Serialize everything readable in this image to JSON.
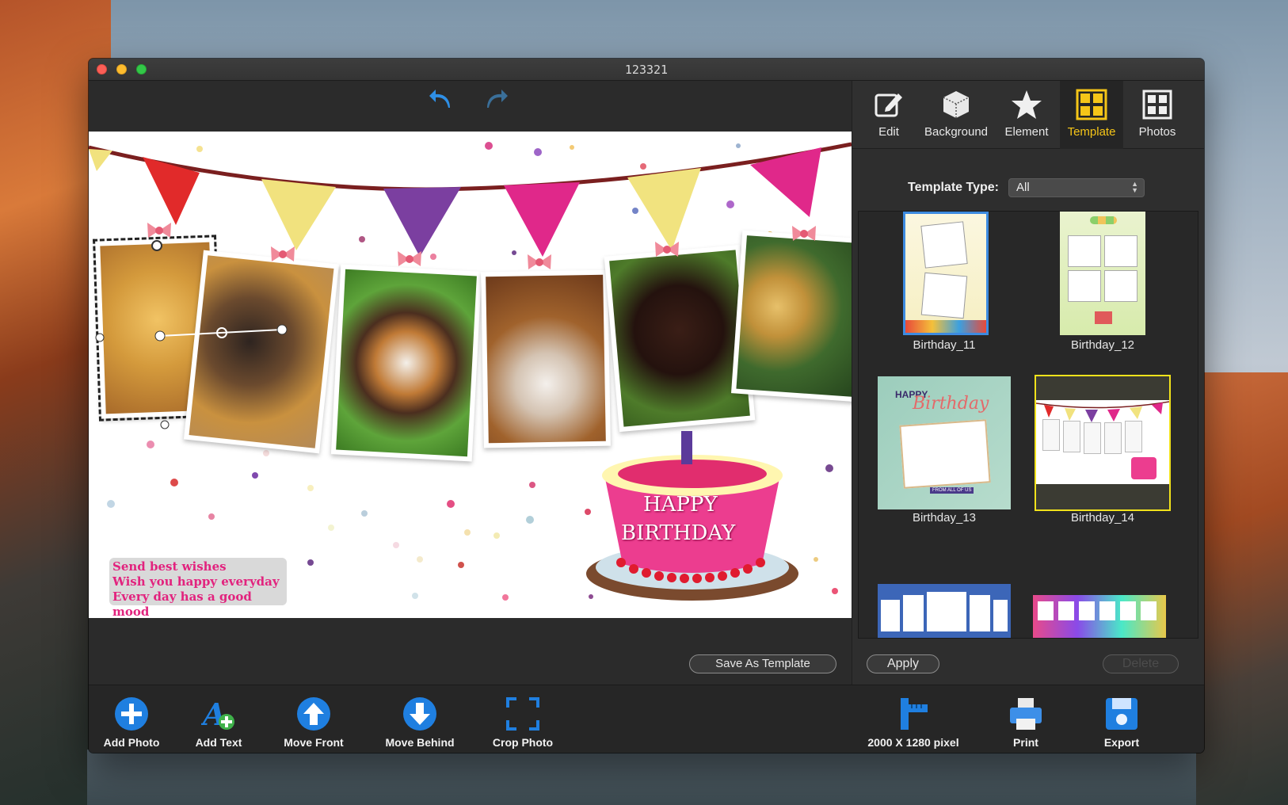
{
  "window": {
    "title": "123321"
  },
  "editor": {
    "save_as_template_label": "Save As Template",
    "caption_lines": [
      "Send best wishes",
      "Wish you happy everyday",
      "Every day has a good mood"
    ],
    "cake_text_line1": "HAPPY",
    "cake_text_line2": "BIRTHDAY"
  },
  "tabs": [
    {
      "label": "Edit",
      "icon": "pencil-square-icon"
    },
    {
      "label": "Background",
      "icon": "cube-icon"
    },
    {
      "label": "Element",
      "icon": "star-icon"
    },
    {
      "label": "Template",
      "icon": "grid-icon",
      "active": true
    },
    {
      "label": "Photos",
      "icon": "photos-grid-icon"
    }
  ],
  "template_type": {
    "label": "Template Type:",
    "value": "All"
  },
  "templates": [
    {
      "name": "Birthday_11"
    },
    {
      "name": "Birthday_12"
    },
    {
      "name": "Birthday_13"
    },
    {
      "name": "Birthday_14",
      "selected": true
    },
    {
      "name": ""
    },
    {
      "name": ""
    }
  ],
  "thumb13_text": "Birthday",
  "thumb13_top": "HAPPY",
  "thumb13_bottom": "FROM ALL OF US",
  "buttons": {
    "apply": "Apply",
    "delete": "Delete"
  },
  "toolbar": {
    "add_photo": "Add Photo",
    "add_text": "Add Text",
    "move_front": "Move Front",
    "move_behind": "Move Behind",
    "crop_photo": "Crop Photo",
    "size": "2000 X 1280 pixel",
    "print": "Print",
    "export": "Export"
  },
  "colors": {
    "accent": "#f5c518",
    "selection": "#f1e21b",
    "tool_blue": "#1f7fe0",
    "caption_pink": "#e2237e"
  }
}
